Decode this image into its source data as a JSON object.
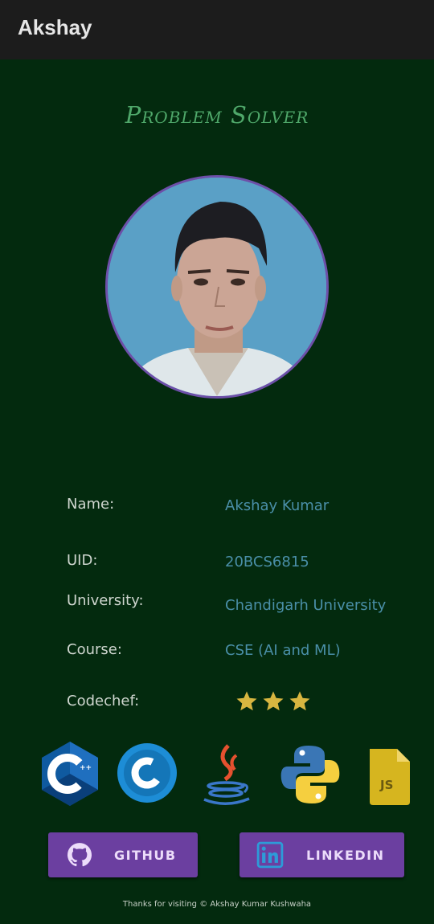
{
  "appbar": {
    "title": "Akshay"
  },
  "headline": "Problem Solver",
  "profile": {
    "rows": [
      {
        "label": "Name:",
        "value": "Akshay Kumar"
      },
      {
        "label": "UID:",
        "value": "20BCS6815"
      },
      {
        "label": "University:",
        "value": "Chandigarh University"
      },
      {
        "label": "Course:",
        "value": "CSE (AI and ML)"
      }
    ],
    "codechef_label": "Codechef:",
    "codechef_stars": 3
  },
  "languages": [
    "cpp-icon",
    "c-icon",
    "java-icon",
    "python-icon",
    "javascript-icon"
  ],
  "buttons": {
    "github": "GITHUB",
    "linkedin": "LINKEDIN"
  },
  "footer": "Thanks for visiting © Akshay Kumar Kushwaha",
  "colors": {
    "background": "#032a0e",
    "appbar": "#1c1c1c",
    "accent": "#6b3fa0",
    "headline": "#4fa86a",
    "value": "#4a8fa8",
    "star": "#d8b640"
  }
}
